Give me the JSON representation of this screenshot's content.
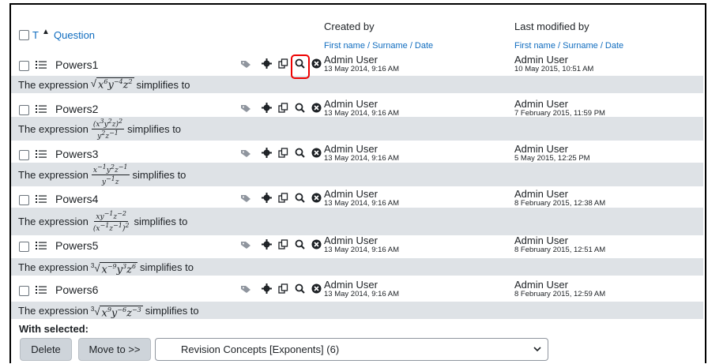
{
  "header": {
    "col_t": "T",
    "col_question": "Question",
    "created_by": "Created by",
    "created_sub": "First name / Surname / Date",
    "modified_by": "Last modified by",
    "modified_sub": "First name / Surname / Date"
  },
  "rows": [
    {
      "name": "Powers1",
      "created_user": "Admin User",
      "created_date": "13 May 2014, 9:16 AM",
      "modified_user": "Admin User",
      "modified_date": "10 May 2015, 10:51 AM",
      "text_prefix": "The expression",
      "text_suffix": "simplifies to"
    },
    {
      "name": "Powers2",
      "created_user": "Admin User",
      "created_date": "13 May 2014, 9:16 AM",
      "modified_user": "Admin User",
      "modified_date": "7 February 2015, 11:59 PM",
      "text_prefix": "The expression",
      "text_suffix": "simplifies to"
    },
    {
      "name": "Powers3",
      "created_user": "Admin User",
      "created_date": "13 May 2014, 9:16 AM",
      "modified_user": "Admin User",
      "modified_date": "5 May 2015, 12:25 PM",
      "text_prefix": "The expression",
      "text_suffix": "simplifies to"
    },
    {
      "name": "Powers4",
      "created_user": "Admin User",
      "created_date": "13 May 2014, 9:16 AM",
      "modified_user": "Admin User",
      "modified_date": "8 February 2015, 12:38 AM",
      "text_prefix": "The expression",
      "text_suffix": "simplifies to"
    },
    {
      "name": "Powers5",
      "created_user": "Admin User",
      "created_date": "13 May 2014, 9:16 AM",
      "modified_user": "Admin User",
      "modified_date": "8 February 2015, 12:51 AM",
      "text_prefix": "The expression",
      "text_suffix": "simplifies to"
    },
    {
      "name": "Powers6",
      "created_user": "Admin User",
      "created_date": "13 May 2014, 9:16 AM",
      "modified_user": "Admin User",
      "modified_date": "8 February 2015, 12:59 AM",
      "text_prefix": "The expression",
      "text_suffix": "simplifies to"
    }
  ],
  "bulk": {
    "with_selected": "With selected:",
    "delete_label": "Delete",
    "move_label": "Move to >>",
    "category_value": "Revision Concepts [Exponents] (6)"
  },
  "colors": {
    "link": "#0f6cbf",
    "row_alt_bg": "#dee2e6",
    "highlight": "#e00000",
    "button_bg": "#ced4da"
  },
  "icons": [
    "tag-icon",
    "gear-icon",
    "copy-icon",
    "preview-icon",
    "delete-icon",
    "list-icon",
    "sort-up-icon",
    "chevron-down-icon"
  ]
}
